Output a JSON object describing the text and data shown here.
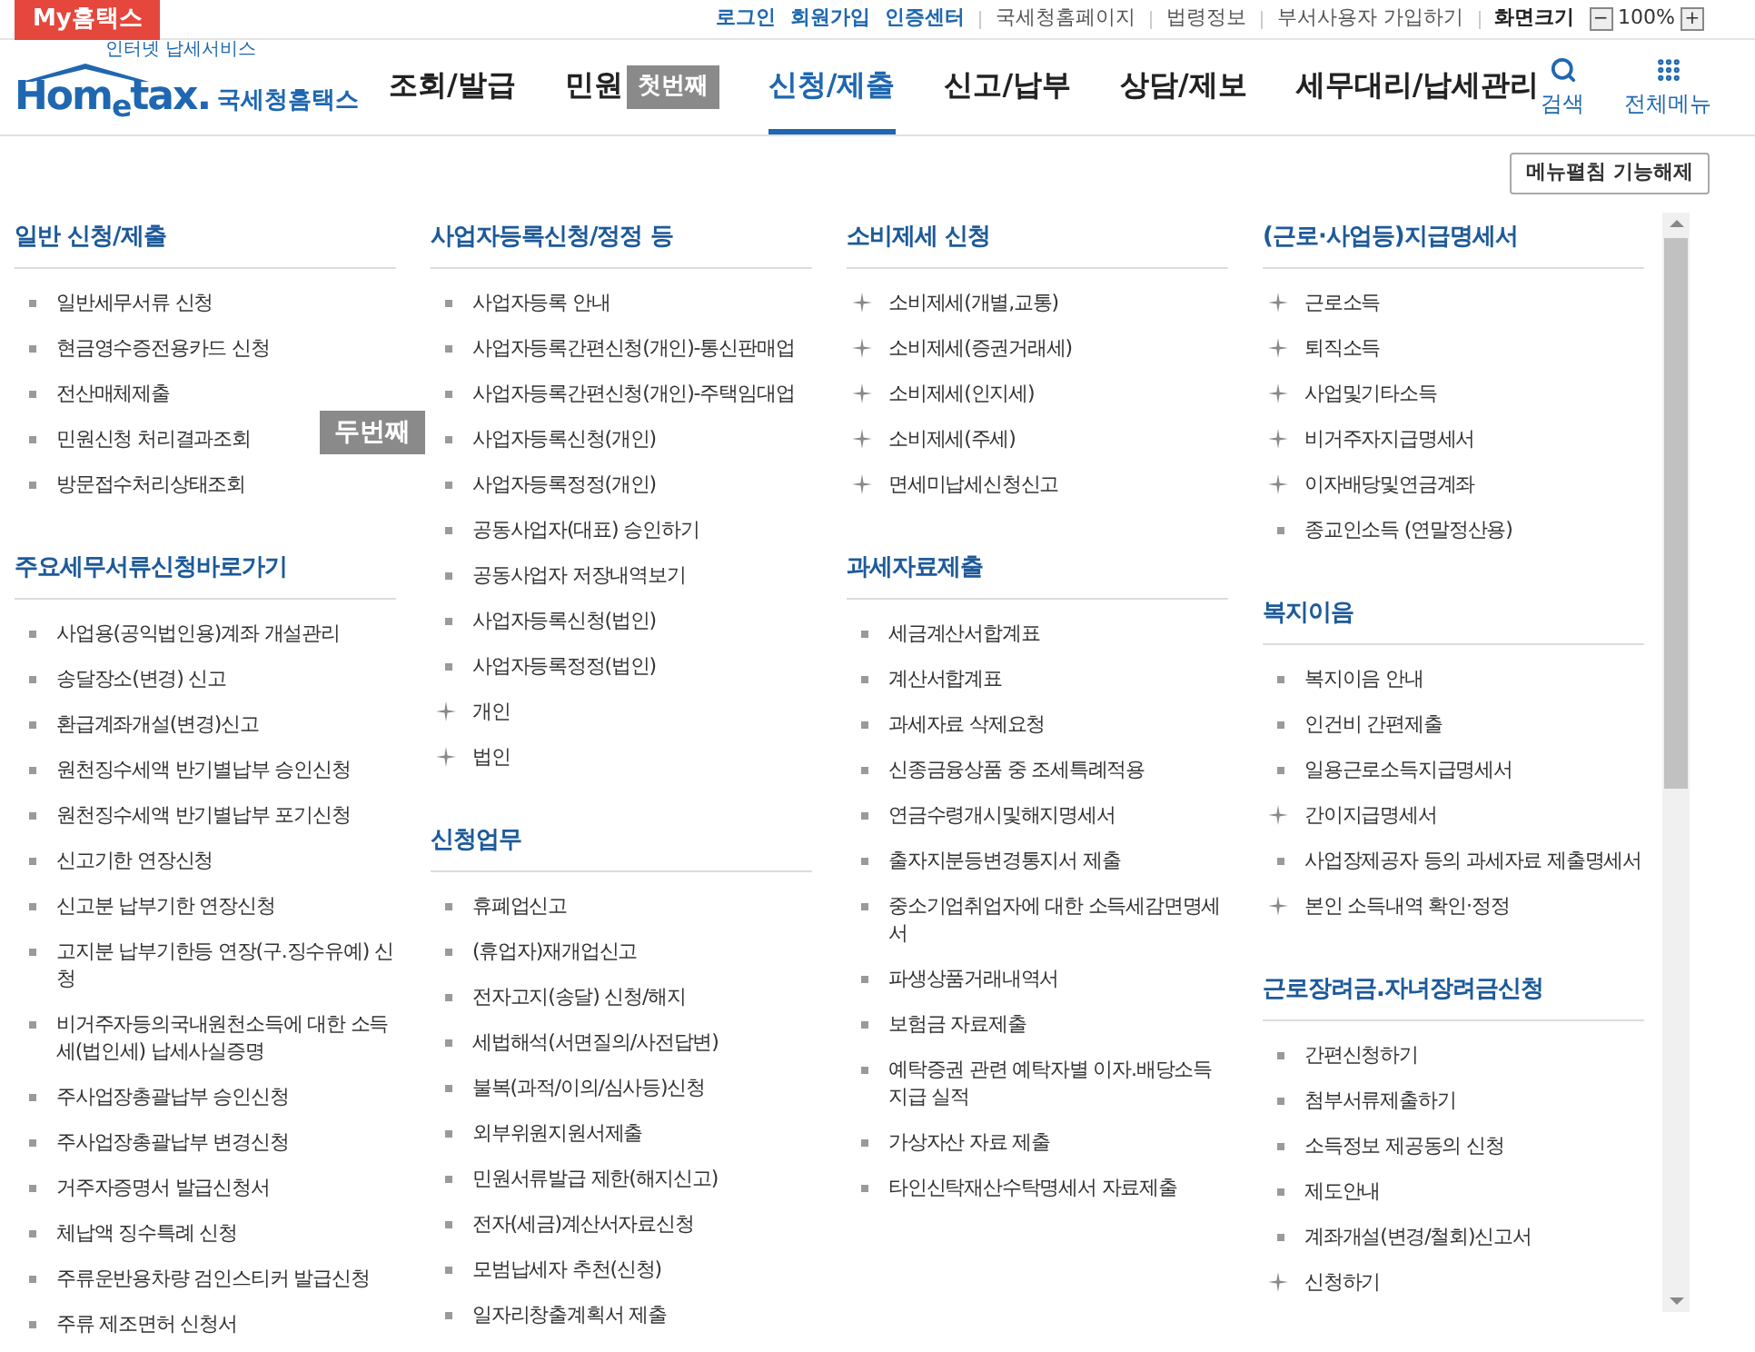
{
  "top_bar": {
    "my_tab": "My홈택스",
    "account_links": [
      "로그인",
      "회원가입",
      "인증센터"
    ],
    "links": [
      "국세청홈페이지",
      "법령정보",
      "부서사용자 가입하기"
    ],
    "zoom_label": "화면크기",
    "zoom_minus": "−",
    "zoom_value": "100%",
    "zoom_plus": "+"
  },
  "logo": {
    "tagline": "인터넷 납세서비스",
    "wordmark": "Hom$_{e}$tax.",
    "name": "국세청홈택스"
  },
  "nav": [
    {
      "label": "조회/발급",
      "selected": false
    },
    {
      "label": "민원",
      "selected": false,
      "callout": "첫번째"
    },
    {
      "label": "신청/제출",
      "selected": true
    },
    {
      "label": "신고/납부",
      "selected": false
    },
    {
      "label": "상담/제보",
      "selected": false
    },
    {
      "label": "세무대리/납세관리",
      "selected": false
    }
  ],
  "nav_tools": [
    {
      "kind": "search",
      "label": "검색"
    },
    {
      "kind": "grid",
      "label": "전체메뉴"
    }
  ],
  "menu_toggle_button": "메뉴펼침 기능해제",
  "callouts": [
    {
      "kind": "menu",
      "label": "두번째"
    }
  ],
  "columns": [
    [
      {
        "title": "일반 신청/제출",
        "items": [
          {
            "kind": "bullet",
            "label": "일반세무서류 신청"
          },
          {
            "kind": "bullet",
            "label": "현금영수증전용카드 신청"
          },
          {
            "kind": "bullet",
            "label": "전산매체제출"
          },
          {
            "kind": "bullet",
            "label": "민원신청 처리결과조회"
          },
          {
            "kind": "bullet",
            "label": "방문접수처리상태조회"
          }
        ]
      },
      {
        "title": "주요세무서류신청바로가기",
        "items": [
          {
            "kind": "bullet",
            "label": "사업용(공익법인용)계좌 개설관리"
          },
          {
            "kind": "bullet",
            "label": "송달장소(변경) 신고"
          },
          {
            "kind": "bullet",
            "label": "환급계좌개설(변경)신고"
          },
          {
            "kind": "bullet",
            "label": "원천징수세액 반기별납부 승인신청"
          },
          {
            "kind": "bullet",
            "label": "원천징수세액 반기별납부 포기신청"
          },
          {
            "kind": "bullet",
            "label": "신고기한 연장신청"
          },
          {
            "kind": "bullet",
            "label": "신고분 납부기한 연장신청"
          },
          {
            "kind": "bullet",
            "label": "고지분 납부기한등 연장(구.징수유예) 신청"
          },
          {
            "kind": "bullet",
            "label": "비거주자등의국내원천소득에 대한 소득세(법인세) 납세사실증명"
          },
          {
            "kind": "bullet",
            "label": "주사업장총괄납부 승인신청"
          },
          {
            "kind": "bullet",
            "label": "주사업장총괄납부 변경신청"
          },
          {
            "kind": "bullet",
            "label": "거주자증명서 발급신청서"
          },
          {
            "kind": "bullet",
            "label": "체납액 징수특례 신청"
          },
          {
            "kind": "bullet",
            "label": "주류운반용차량 검인스티커 발급신청"
          },
          {
            "kind": "bullet",
            "label": "주류 제조면허 신청서"
          }
        ]
      }
    ],
    [
      {
        "title": "사업자등록신청/정정 등",
        "items": [
          {
            "kind": "bullet",
            "label": "사업자등록 안내"
          },
          {
            "kind": "bullet",
            "label": "사업자등록간편신청(개인)-통신판매업"
          },
          {
            "kind": "bullet",
            "label": "사업자등록간편신청(개인)-주택임대업"
          },
          {
            "kind": "bullet",
            "label": "사업자등록신청(개인)"
          },
          {
            "kind": "bullet",
            "label": "사업자등록정정(개인)"
          },
          {
            "kind": "bullet",
            "label": "공동사업자(대표) 승인하기"
          },
          {
            "kind": "bullet",
            "label": "공동사업자 저장내역보기"
          },
          {
            "kind": "bullet",
            "label": "사업자등록신청(법인)"
          },
          {
            "kind": "bullet",
            "label": "사업자등록정정(법인)"
          },
          {
            "kind": "plus",
            "label": "개인"
          },
          {
            "kind": "plus",
            "label": "법인"
          }
        ]
      },
      {
        "title": "신청업무",
        "items": [
          {
            "kind": "bullet",
            "label": "휴폐업신고"
          },
          {
            "kind": "bullet",
            "label": "(휴업자)재개업신고"
          },
          {
            "kind": "bullet",
            "label": "전자고지(송달) 신청/해지"
          },
          {
            "kind": "bullet",
            "label": "세법해석(서면질의/사전답변)"
          },
          {
            "kind": "bullet",
            "label": "불복(과적/이의/심사등)신청"
          },
          {
            "kind": "bullet",
            "label": "외부위원지원서제출"
          },
          {
            "kind": "bullet",
            "label": "민원서류발급 제한(해지신고)"
          },
          {
            "kind": "bullet",
            "label": "전자(세금)계산서자료신청"
          },
          {
            "kind": "bullet",
            "label": "모범납세자 추천(신청)"
          },
          {
            "kind": "bullet",
            "label": "일자리창출계획서 제출"
          }
        ]
      }
    ],
    [
      {
        "title": "소비제세 신청",
        "items": [
          {
            "kind": "plus",
            "label": "소비제세(개별,교통)"
          },
          {
            "kind": "plus",
            "label": "소비제세(증권거래세)"
          },
          {
            "kind": "plus",
            "label": "소비제세(인지세)"
          },
          {
            "kind": "plus",
            "label": "소비제세(주세)"
          },
          {
            "kind": "plus",
            "label": "면세미납세신청신고"
          }
        ]
      },
      {
        "title": "과세자료제출",
        "items": [
          {
            "kind": "bullet",
            "label": "세금계산서합계표"
          },
          {
            "kind": "bullet",
            "label": "계산서합계표"
          },
          {
            "kind": "bullet",
            "label": "과세자료 삭제요청"
          },
          {
            "kind": "bullet",
            "label": "신종금융상품 중 조세특례적용"
          },
          {
            "kind": "bullet",
            "label": "연금수령개시및해지명세서"
          },
          {
            "kind": "bullet",
            "label": "출자지분등변경통지서 제출"
          },
          {
            "kind": "bullet",
            "label": "중소기업취업자에 대한 소득세감면명세서"
          },
          {
            "kind": "bullet",
            "label": "파생상품거래내역서"
          },
          {
            "kind": "bullet",
            "label": "보험금 자료제출"
          },
          {
            "kind": "bullet",
            "label": "예탁증권 관련 예탁자별 이자.배당소득 지급 실적"
          },
          {
            "kind": "bullet",
            "label": "가상자산 자료 제출"
          },
          {
            "kind": "bullet",
            "label": "타인신탁재산수탁명세서 자료제출"
          }
        ]
      }
    ],
    [
      {
        "title": "(근로·사업등)지급명세서",
        "items": [
          {
            "kind": "plus",
            "label": "근로소득"
          },
          {
            "kind": "plus",
            "label": "퇴직소득"
          },
          {
            "kind": "plus",
            "label": "사업및기타소득"
          },
          {
            "kind": "plus",
            "label": "비거주자지급명세서"
          },
          {
            "kind": "plus",
            "label": "이자배당및연금계좌"
          },
          {
            "kind": "bullet",
            "label": "종교인소득 (연말정산용)"
          }
        ]
      },
      {
        "title": "복지이음",
        "items": [
          {
            "kind": "bullet",
            "label": "복지이음 안내"
          },
          {
            "kind": "bullet",
            "label": "인건비 간편제출"
          },
          {
            "kind": "bullet",
            "label": "일용근로소득지급명세서"
          },
          {
            "kind": "plus",
            "label": "간이지급명세서"
          },
          {
            "kind": "bullet",
            "label": "사업장제공자 등의 과세자료 제출명세서"
          },
          {
            "kind": "plus",
            "label": "본인 소득내역 확인·정정"
          }
        ]
      },
      {
        "title": "근로장려금.자녀장려금신청",
        "items": [
          {
            "kind": "bullet",
            "label": "간편신청하기"
          },
          {
            "kind": "bullet",
            "label": "첨부서류제출하기"
          },
          {
            "kind": "bullet",
            "label": "소득정보 제공동의 신청"
          },
          {
            "kind": "bullet",
            "label": "제도안내"
          },
          {
            "kind": "bullet",
            "label": "계좌개설(변경/철회)신고서"
          },
          {
            "kind": "plus",
            "label": "신청하기"
          }
        ]
      }
    ]
  ]
}
